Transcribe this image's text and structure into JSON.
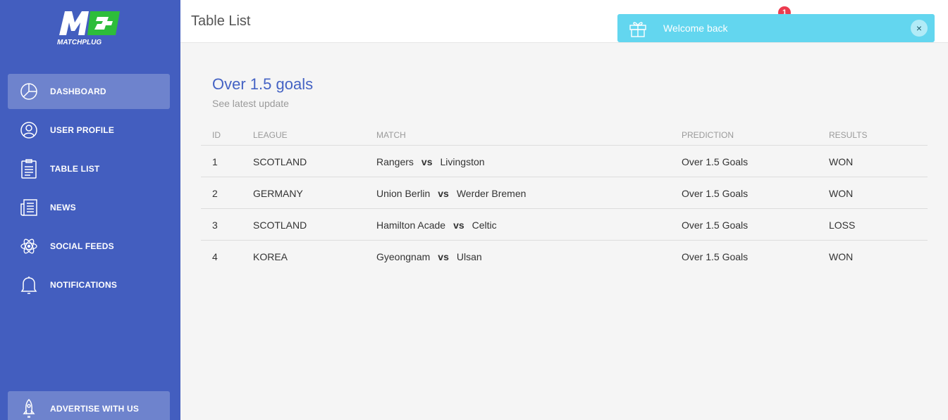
{
  "brand": {
    "logo_text": "MATCHPLUG",
    "logo_mark": "M"
  },
  "sidebar": {
    "items": [
      {
        "label": "DASHBOARD",
        "icon": "pie-chart-icon",
        "active": true
      },
      {
        "label": "USER PROFILE",
        "icon": "user-icon",
        "active": false
      },
      {
        "label": "TABLE LIST",
        "icon": "clipboard-icon",
        "active": false
      },
      {
        "label": "NEWS",
        "icon": "newspaper-icon",
        "active": false
      },
      {
        "label": "SOCIAL FEEDS",
        "icon": "atom-icon",
        "active": false
      },
      {
        "label": "NOTIFICATIONS",
        "icon": "bell-icon",
        "active": false
      }
    ],
    "advertise_label": "ADVERTISE WITH US"
  },
  "header": {
    "title": "Table List",
    "notification_count": "1"
  },
  "toast": {
    "message": "Welcome back",
    "close": "×"
  },
  "card": {
    "title": "Over 1.5 goals",
    "subtitle": "See latest update"
  },
  "table": {
    "headers": {
      "id": "ID",
      "league": "LEAGUE",
      "match": "MATCH",
      "prediction": "PREDICTION",
      "results": "RESULTS"
    },
    "rows": [
      {
        "id": "1",
        "league": "SCOTLAND",
        "home": "Rangers",
        "vs": "vs",
        "away": "Livingston",
        "prediction": "Over 1.5 Goals",
        "result": "WON"
      },
      {
        "id": "2",
        "league": "GERMANY",
        "home": "Union Berlin",
        "vs": "vs",
        "away": "Werder Bremen",
        "prediction": "Over 1.5 Goals",
        "result": "WON"
      },
      {
        "id": "3",
        "league": "SCOTLAND",
        "home": "Hamilton Acade",
        "vs": "vs",
        "away": "Celtic",
        "prediction": "Over 1.5 Goals",
        "result": "LOSS"
      },
      {
        "id": "4",
        "league": "KOREA",
        "home": "Gyeongnam",
        "vs": "vs",
        "away": "Ulsan",
        "prediction": "Over 1.5 Goals",
        "result": "WON"
      }
    ]
  },
  "colors": {
    "sidebar": "#435ebf",
    "accent": "#4563c4",
    "toast": "#63d6ef",
    "badge": "#ec3b4f",
    "logo_green": "#2dbd3a"
  }
}
